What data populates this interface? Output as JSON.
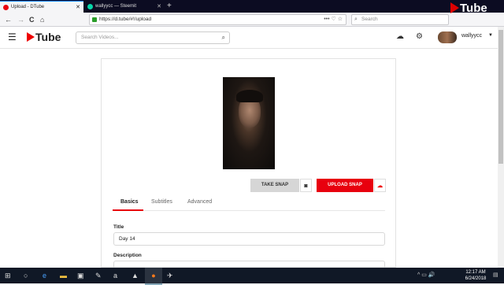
{
  "browser": {
    "tabs": [
      {
        "label": "Upload - DTube",
        "favicon_color": "#e8000e",
        "active": true
      },
      {
        "label": "wallyycc — Steemit",
        "favicon_color": "#06d6a9",
        "active": false
      }
    ],
    "new_tab_label": "+",
    "url": "https://d.tube/#!/upload",
    "search_placeholder": "Search",
    "url_icons": "••• ♡ ☆",
    "nav": {
      "back": "←",
      "forward": "→",
      "reload": "C",
      "home": "⌂"
    }
  },
  "watermark": {
    "text": "Tube"
  },
  "app": {
    "logo_text": "Tube",
    "search_placeholder": "Search Videos...",
    "username": "wallyycc",
    "icons": [
      "cloud-upload-icon",
      "gears-icon"
    ]
  },
  "upload": {
    "take_snap_label": "TAKE SNAP",
    "upload_snap_label": "UPLOAD SNAP",
    "tabs": [
      "Basics",
      "Subtitles",
      "Advanced"
    ],
    "active_tab": "Basics",
    "title_label": "Title",
    "title_value": "Day 14",
    "description_label": "Description"
  },
  "taskbar": {
    "time": "12:17 AM",
    "date": "6/24/2018",
    "tray": "^ ▭ 🔊"
  },
  "colors": {
    "brand": "#e8000e",
    "taskbar": "#101826"
  }
}
